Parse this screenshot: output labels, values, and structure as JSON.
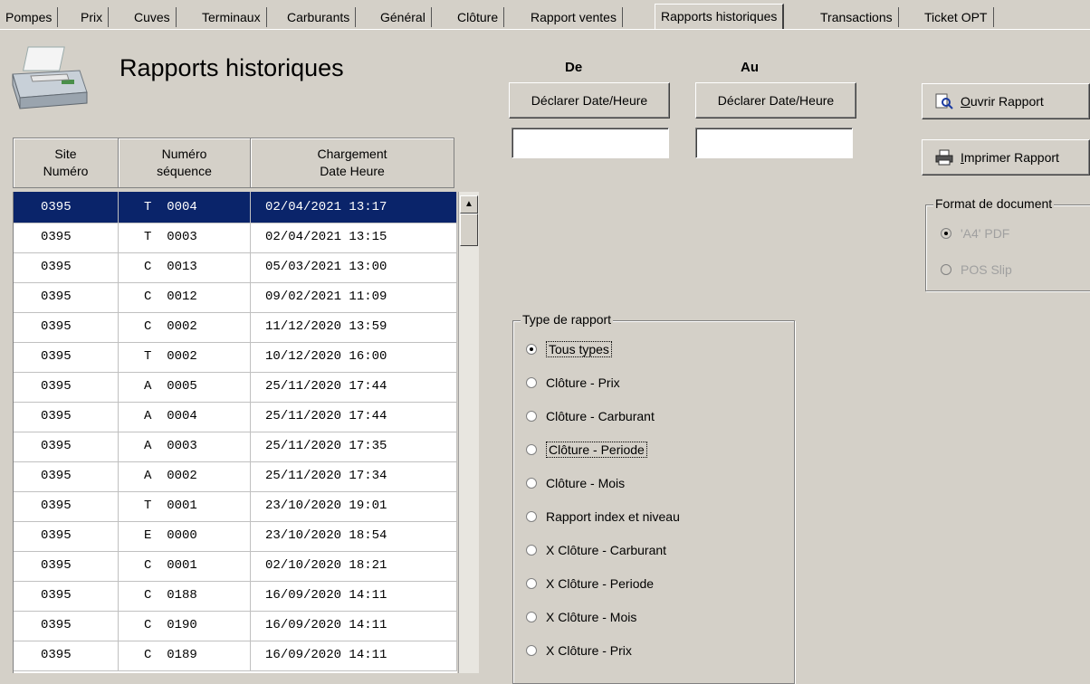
{
  "tabs": [
    "Pompes",
    "Prix",
    "Cuves",
    "Terminaux",
    "Carburants",
    "Général",
    "Clôture",
    "Rapport ventes",
    "Rapports historiques",
    "Transactions",
    "Ticket OPT"
  ],
  "active_tab": "Rapports historiques",
  "page_title": "Rapports historiques",
  "table": {
    "headers": [
      "Site\nNuméro",
      "Numéro\nséquence",
      "Chargement\nDate Heure"
    ],
    "rows": [
      {
        "site": "0395",
        "seq": "T  0004",
        "date": "02/04/2021 13:17",
        "selected": true
      },
      {
        "site": "0395",
        "seq": "T  0003",
        "date": "02/04/2021 13:15"
      },
      {
        "site": "0395",
        "seq": "C  0013",
        "date": "05/03/2021 13:00"
      },
      {
        "site": "0395",
        "seq": "C  0012",
        "date": "09/02/2021 11:09"
      },
      {
        "site": "0395",
        "seq": "C  0002",
        "date": "11/12/2020 13:59"
      },
      {
        "site": "0395",
        "seq": "T  0002",
        "date": "10/12/2020 16:00"
      },
      {
        "site": "0395",
        "seq": "A  0005",
        "date": "25/11/2020 17:44"
      },
      {
        "site": "0395",
        "seq": "A  0004",
        "date": "25/11/2020 17:44"
      },
      {
        "site": "0395",
        "seq": "A  0003",
        "date": "25/11/2020 17:35"
      },
      {
        "site": "0395",
        "seq": "A  0002",
        "date": "25/11/2020 17:34"
      },
      {
        "site": "0395",
        "seq": "T  0001",
        "date": "23/10/2020 19:01"
      },
      {
        "site": "0395",
        "seq": "E  0000",
        "date": "23/10/2020 18:54"
      },
      {
        "site": "0395",
        "seq": "C  0001",
        "date": "02/10/2020 18:21"
      },
      {
        "site": "0395",
        "seq": "C  0188",
        "date": "16/09/2020 14:11"
      },
      {
        "site": "0395",
        "seq": "C  0190",
        "date": "16/09/2020 14:11"
      },
      {
        "site": "0395",
        "seq": "C  0189",
        "date": "16/09/2020 14:11"
      }
    ]
  },
  "date_from": {
    "label": "De",
    "button": "Déclarer Date/Heure",
    "value": ""
  },
  "date_to": {
    "label": "Au",
    "button": "Déclarer Date/Heure",
    "value": ""
  },
  "open_report": {
    "mnemonic": "O",
    "rest": "uvrir Rapport"
  },
  "print_report": {
    "mnemonic": "I",
    "rest": "mprimer Rapport"
  },
  "doc_format": {
    "title": "Format de document",
    "options": [
      {
        "label": "'A4' PDF",
        "checked": true
      },
      {
        "label": "POS Slip",
        "checked": false
      }
    ]
  },
  "report_type": {
    "title": "Type de rapport",
    "options": [
      {
        "label": "Tous types",
        "checked": true
      },
      {
        "label": "Clôture - Prix",
        "checked": false
      },
      {
        "label": "Clôture - Carburant",
        "checked": false
      },
      {
        "label": "Clôture - Periode",
        "checked": false
      },
      {
        "label": "Clôture - Mois",
        "checked": false
      },
      {
        "label": "Rapport index et niveau",
        "checked": false
      },
      {
        "label": "X Clôture - Carburant",
        "checked": false
      },
      {
        "label": "X Clôture - Periode",
        "checked": false
      },
      {
        "label": "X Clôture - Mois",
        "checked": false
      },
      {
        "label": "X Clôture - Prix",
        "checked": false
      }
    ]
  },
  "colors": {
    "selection": "#0a246a",
    "background": "#d4d0c8"
  },
  "icons": [
    "printer-icon",
    "open-report-icon",
    "print-report-icon",
    "scroll-up-icon"
  ]
}
